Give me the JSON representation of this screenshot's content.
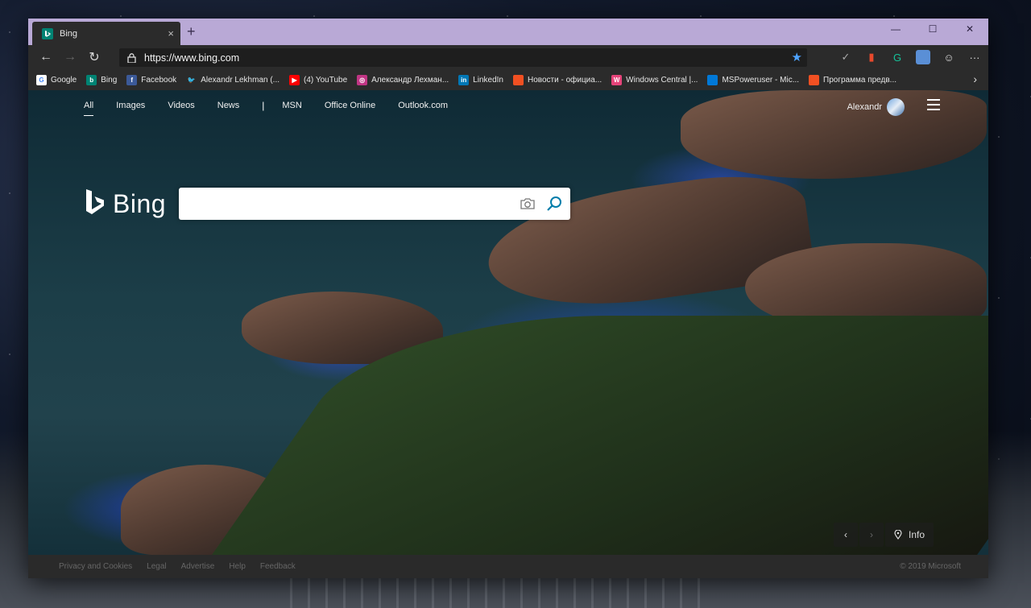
{
  "tab": {
    "title": "Bing",
    "close": "×",
    "new_tab": "+"
  },
  "window_controls": {
    "minimize": "—",
    "maximize": "☐",
    "close": "✕"
  },
  "address_bar": {
    "url": "https://www.bing.com",
    "favorite_icon": "star-icon"
  },
  "nav": {
    "back": "←",
    "forward": "→",
    "refresh": "↻"
  },
  "extensions": [
    {
      "name": "ext-check-icon",
      "glyph": "✓",
      "color": "#aaaaaa"
    },
    {
      "name": "office-icon",
      "glyph": "▮",
      "color": "#e8492c"
    },
    {
      "name": "grammarly-icon",
      "glyph": "G",
      "color": "#15c39a"
    },
    {
      "name": "profile-icon",
      "glyph": "",
      "color": "#5a8fd6"
    },
    {
      "name": "smiley-icon",
      "glyph": "☺",
      "color": "#dddddd"
    },
    {
      "name": "more-icon",
      "glyph": "···",
      "color": "#dddddd"
    }
  ],
  "favorites": [
    {
      "label": "Google",
      "icon": "G",
      "color": "#ffffff",
      "fg": "#4285f4"
    },
    {
      "label": "Bing",
      "icon": "b",
      "color": "#008373",
      "fg": "#ffffff"
    },
    {
      "label": "Facebook",
      "icon": "f",
      "color": "#3b5998",
      "fg": "#ffffff"
    },
    {
      "label": "Alexandr Lekhman (...",
      "icon": "🐦",
      "color": "transparent",
      "fg": "#1da1f2"
    },
    {
      "label": "(4) YouTube",
      "icon": "▶",
      "color": "#ff0000",
      "fg": "#ffffff"
    },
    {
      "label": "Александр Лехман...",
      "icon": "◎",
      "color": "#c13584",
      "fg": "#ffffff"
    },
    {
      "label": "LinkedIn",
      "icon": "in",
      "color": "#0077b5",
      "fg": "#ffffff"
    },
    {
      "label": "Новости - официа...",
      "icon": "",
      "color": "#f25022",
      "fg": "#ffffff"
    },
    {
      "label": "Windows Central |...",
      "icon": "W",
      "color": "#e6447a",
      "fg": "#ffffff"
    },
    {
      "label": "MSPoweruser - Mic...",
      "icon": "",
      "color": "#0078d7",
      "fg": "#ffffff"
    },
    {
      "label": "Программа предв...",
      "icon": "",
      "color": "#f25022",
      "fg": "#ffffff"
    }
  ],
  "favorites_more": "›",
  "bing": {
    "nav": [
      "All",
      "Images",
      "Videos",
      "News"
    ],
    "nav_sep": "|",
    "nav2": [
      "MSN",
      "Office Online",
      "Outlook.com"
    ],
    "user_name": "Alexandr",
    "logo_text": "Bing",
    "search_placeholder": "",
    "info_label": "Info",
    "prev": "‹",
    "next": "›"
  },
  "footer": {
    "links": [
      "Privacy and Cookies",
      "Legal",
      "Advertise",
      "Help",
      "Feedback"
    ],
    "copyright": "© 2019 Microsoft"
  }
}
